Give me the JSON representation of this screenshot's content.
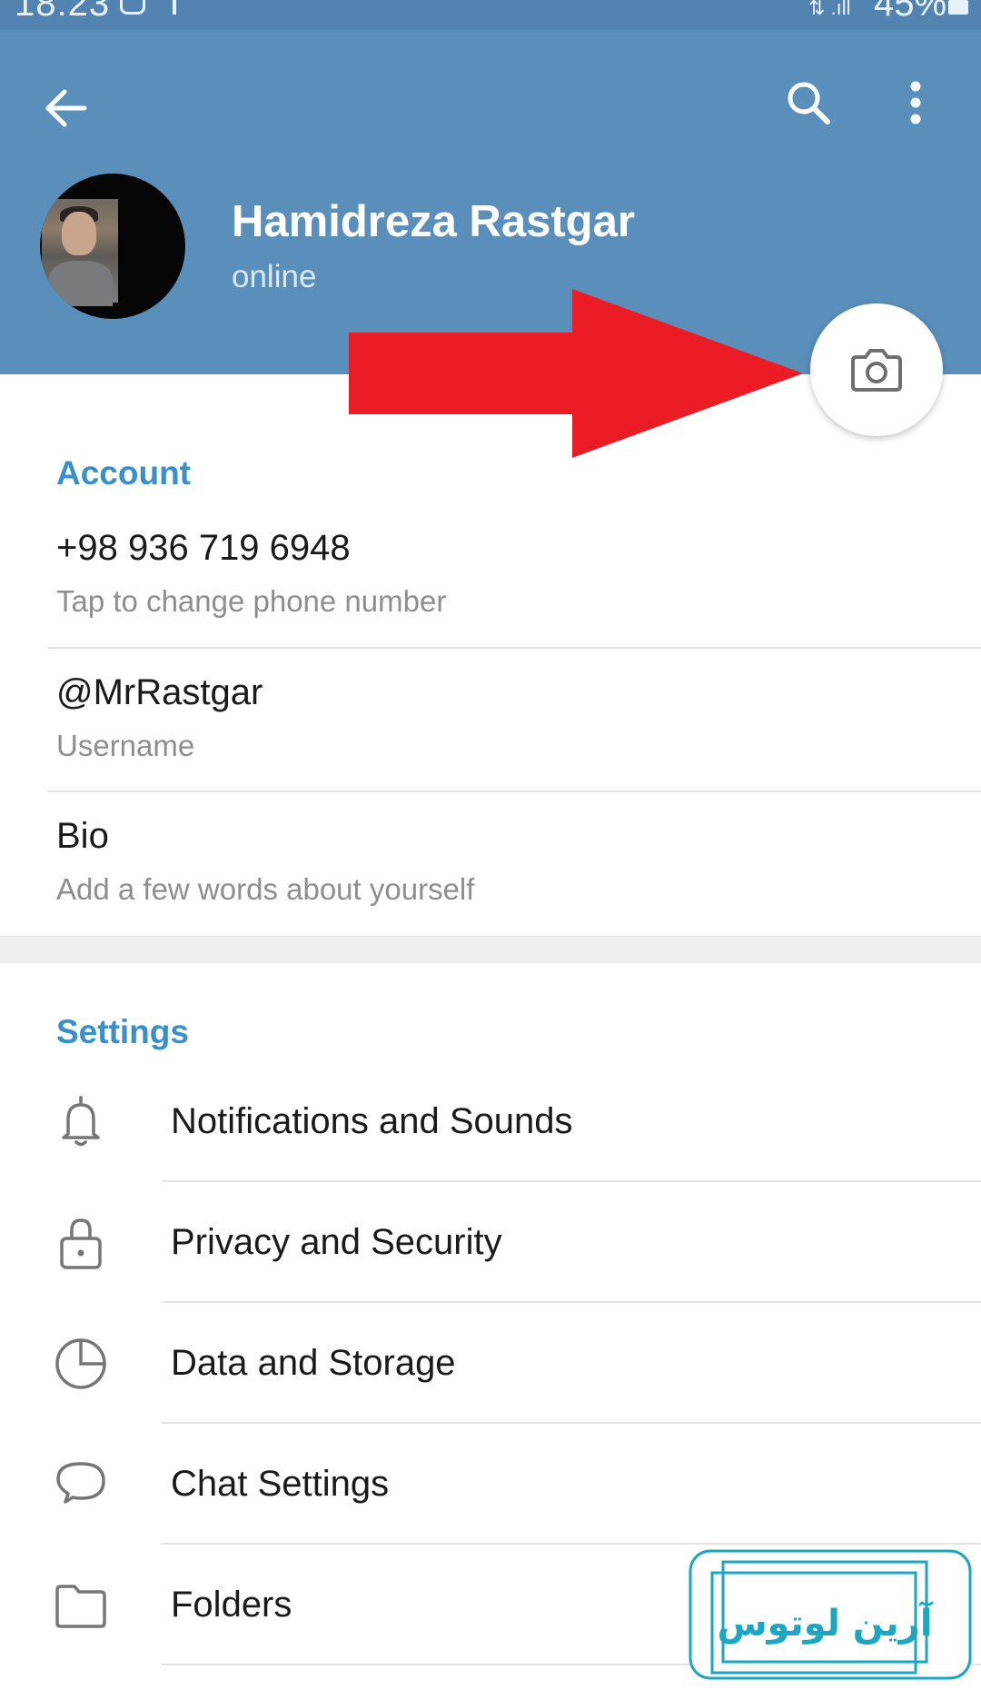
{
  "status_bar": {
    "time": "18:23",
    "signal": "⇅ .ıll",
    "battery": "45%"
  },
  "header": {
    "back_icon": "arrow-left-icon",
    "search_icon": "search-icon",
    "more_icon": "more-vertical-icon"
  },
  "profile": {
    "name": "Hamidreza Rastgar",
    "status": "online",
    "camera_icon": "camera-icon"
  },
  "account": {
    "title": "Account",
    "phone": {
      "value": "+98 936 719 6948",
      "hint": "Tap to change phone number"
    },
    "username": {
      "value": "@MrRastgar",
      "hint": "Username"
    },
    "bio": {
      "value": "Bio",
      "hint": "Add a few words about yourself"
    }
  },
  "settings": {
    "title": "Settings",
    "items": [
      {
        "label": "Notifications and Sounds",
        "icon": "bell-icon"
      },
      {
        "label": "Privacy and Security",
        "icon": "lock-icon"
      },
      {
        "label": "Data and Storage",
        "icon": "pie-chart-icon"
      },
      {
        "label": "Chat Settings",
        "icon": "chat-bubble-icon"
      },
      {
        "label": "Folders",
        "icon": "folder-icon"
      }
    ]
  },
  "watermark": {
    "text": "آرین لوتوس"
  },
  "colors": {
    "header_bg": "#5a8fbb",
    "accent": "#3a8fc8",
    "arrow": "#ec1c24",
    "watermark": "#1ba6c3"
  }
}
